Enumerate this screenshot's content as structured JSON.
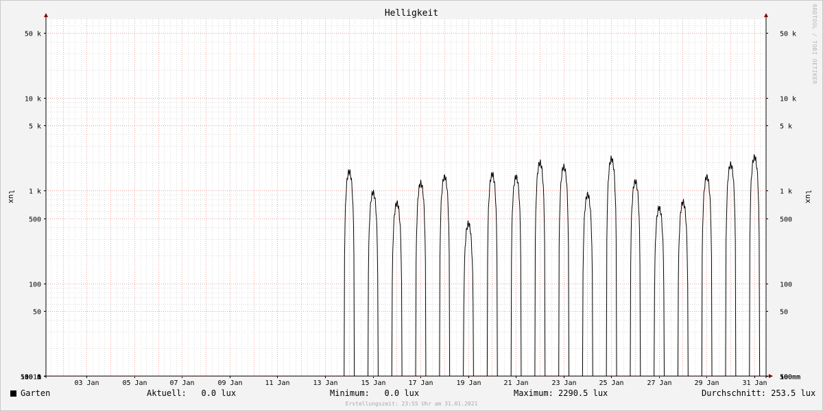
{
  "chart_data": {
    "type": "line",
    "title": "Helligkeit",
    "ylabel": "lux",
    "y_scale": "log",
    "ylim": [
      10,
      70000
    ],
    "xlim": [
      "2021-01-01T19:00",
      "2021-01-31T23:55"
    ],
    "grid": true,
    "x_ticks": [
      "03 Jan",
      "05 Jan",
      "07 Jan",
      "09 Jan",
      "11 Jan",
      "13 Jan",
      "15 Jan",
      "17 Jan",
      "19 Jan",
      "21 Jan",
      "23 Jan",
      "25 Jan",
      "27 Jan",
      "29 Jan",
      "31 Jan"
    ],
    "x_tick_dates": [
      "2021-01-03",
      "2021-01-05",
      "2021-01-07",
      "2021-01-09",
      "2021-01-11",
      "2021-01-13",
      "2021-01-15",
      "2021-01-17",
      "2021-01-19",
      "2021-01-21",
      "2021-01-23",
      "2021-01-25",
      "2021-01-27",
      "2021-01-29",
      "2021-01-31"
    ],
    "y_ticks": [
      {
        "value": 50000,
        "label": "50 k"
      },
      {
        "value": 10000,
        "label": "10 k"
      },
      {
        "value": 5000,
        "label": "5 k"
      },
      {
        "value": 1000,
        "label": "1 k"
      },
      {
        "value": 500,
        "label": "500"
      },
      {
        "value": 100,
        "label": "100"
      },
      {
        "value": 50,
        "label": "50"
      },
      {
        "value": 10,
        "label": "10"
      },
      {
        "value": 5,
        "label": "5"
      },
      {
        "value": 1,
        "label": "1"
      },
      {
        "value": 0.5,
        "label": "500 m"
      },
      {
        "value": 0.1,
        "label": "100 m"
      },
      {
        "value": 0.05,
        "label": "50 m"
      },
      {
        "value": 0.01,
        "label": "10 m"
      }
    ],
    "series": [
      {
        "name": "Garten",
        "color": "#000000",
        "daily_peaks": [
          {
            "date": "2021-01-14",
            "peak": 1600
          },
          {
            "date": "2021-01-15",
            "peak": 950
          },
          {
            "date": "2021-01-16",
            "peak": 730
          },
          {
            "date": "2021-01-17",
            "peak": 1200
          },
          {
            "date": "2021-01-18",
            "peak": 1400
          },
          {
            "date": "2021-01-19",
            "peak": 440
          },
          {
            "date": "2021-01-20",
            "peak": 1500
          },
          {
            "date": "2021-01-21",
            "peak": 1400
          },
          {
            "date": "2021-01-22",
            "peak": 2000
          },
          {
            "date": "2021-01-23",
            "peak": 1800
          },
          {
            "date": "2021-01-24",
            "peak": 900
          },
          {
            "date": "2021-01-25",
            "peak": 2200
          },
          {
            "date": "2021-01-26",
            "peak": 1250
          },
          {
            "date": "2021-01-27",
            "peak": 650
          },
          {
            "date": "2021-01-28",
            "peak": 750
          },
          {
            "date": "2021-01-29",
            "peak": 1400
          },
          {
            "date": "2021-01-30",
            "peak": 1900
          },
          {
            "date": "2021-01-31",
            "peak": 2290.5
          }
        ],
        "night_level": 0.05
      }
    ]
  },
  "legend": {
    "series_name": "Garten",
    "current_label": "Aktuell:",
    "current_value": "0.0 lux",
    "min_label": "Minimum:",
    "min_value": "0.0 lux",
    "max_label": "Maximum:",
    "max_value": "2290.5 lux",
    "avg_label": "Durchschnitt:",
    "avg_value": "253.5 lux"
  },
  "footer": "Erstellungszeit: 23:55 Uhr am 31.01.2021",
  "watermark": "RRDTOOL / TOBI OETIKER",
  "colors": {
    "background": "#f3f3f3",
    "plot_background": "#ffffff",
    "major_grid": "#e8a0a0",
    "minor_grid": "#dcdcdc",
    "axis": "#000000",
    "arrow": "#8b0000",
    "line": "#000000"
  }
}
